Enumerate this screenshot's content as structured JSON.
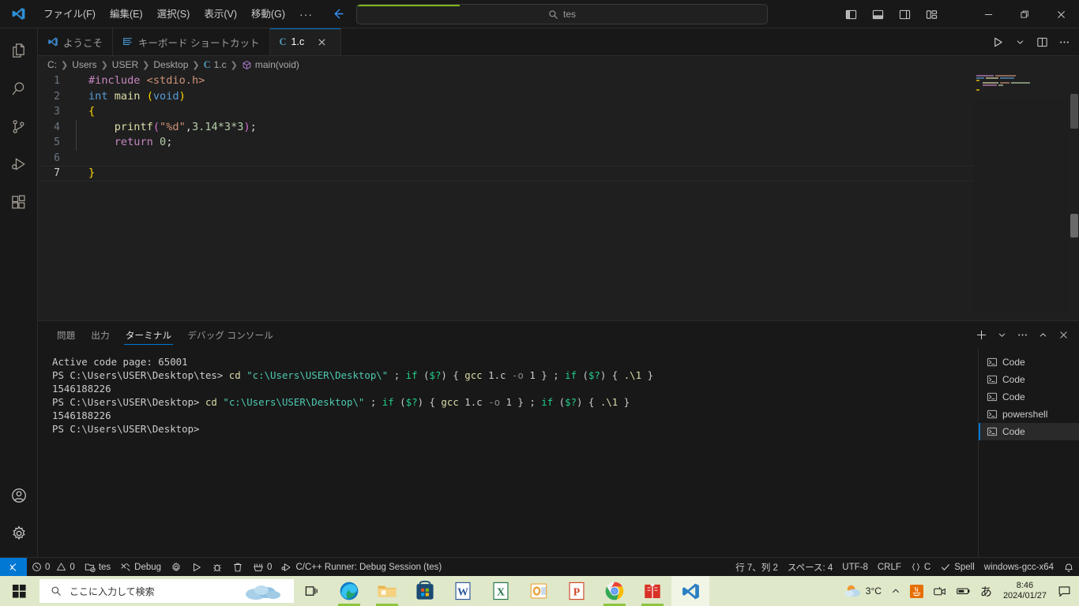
{
  "titlebar": {
    "logo_icon": "vscode-logo-icon",
    "menus": [
      {
        "label": "ファイル(F)",
        "name": "menu-file"
      },
      {
        "label": "編集(E)",
        "name": "menu-edit"
      },
      {
        "label": "選択(S)",
        "name": "menu-selection"
      },
      {
        "label": "表示(V)",
        "name": "menu-view"
      },
      {
        "label": "移動(G)",
        "name": "menu-go"
      }
    ],
    "more_label": "···",
    "back_icon": "arrow-left-icon",
    "forward_icon": "arrow-right-icon",
    "command_center": {
      "search_icon": "search-icon",
      "text": "tes",
      "placeholder": "tes",
      "progress_color": "#7cb518"
    },
    "layout_buttons": [
      {
        "name": "toggle-primary-sidebar-button",
        "icon": "layout-sidebar-left-icon"
      },
      {
        "name": "toggle-panel-button",
        "icon": "layout-panel-icon"
      },
      {
        "name": "toggle-secondary-sidebar-button",
        "icon": "layout-sidebar-right-icon"
      },
      {
        "name": "customize-layout-button",
        "icon": "layout-customize-icon"
      }
    ],
    "window_controls": [
      {
        "name": "minimize-button",
        "icon": "minimize-icon"
      },
      {
        "name": "maximize-restore-button",
        "icon": "restore-icon"
      },
      {
        "name": "close-window-button",
        "icon": "close-icon"
      }
    ]
  },
  "activitybar": {
    "top_items": [
      {
        "name": "activity-explorer",
        "icon": "files-icon",
        "label": "エクスプローラー"
      },
      {
        "name": "activity-search",
        "icon": "search-icon",
        "label": "検索"
      },
      {
        "name": "activity-source-control",
        "icon": "source-control-icon",
        "label": "ソース管理"
      },
      {
        "name": "activity-run-debug",
        "icon": "run-and-debug-icon",
        "label": "実行とデバッグ"
      },
      {
        "name": "activity-extensions",
        "icon": "extensions-icon",
        "label": "拡張機能"
      }
    ],
    "bottom_items": [
      {
        "name": "activity-accounts",
        "icon": "account-icon",
        "label": "アカウント"
      },
      {
        "name": "activity-settings",
        "icon": "gear-icon",
        "label": "管理"
      }
    ]
  },
  "editor": {
    "tabs": [
      {
        "label": "ようこそ",
        "icon": "vscode-logo-icon",
        "active": false,
        "name": "tab-welcome"
      },
      {
        "label": "キーボード ショートカット",
        "icon": "keyboard-shortcuts-icon",
        "active": false,
        "name": "tab-keyboard-shortcuts"
      },
      {
        "label": "1.c",
        "icon": "c-file-icon",
        "active": true,
        "name": "tab-1-c",
        "close_icon": "close-icon"
      }
    ],
    "actions": [
      {
        "name": "run-code-button",
        "icon": "play-icon"
      },
      {
        "name": "run-options-dropdown",
        "icon": "chevron-down-icon"
      },
      {
        "name": "split-editor-button",
        "icon": "split-editor-icon"
      },
      {
        "name": "more-editor-actions-button",
        "icon": "ellipsis-icon"
      }
    ],
    "breadcrumbs": [
      {
        "label": "C:",
        "name": "breadcrumb-drive"
      },
      {
        "label": "Users",
        "name": "breadcrumb-users"
      },
      {
        "label": "USER",
        "name": "breadcrumb-user"
      },
      {
        "label": "Desktop",
        "name": "breadcrumb-desktop"
      },
      {
        "label": "1.c",
        "name": "breadcrumb-file",
        "icon": "c-file-icon"
      },
      {
        "label": "main(void)",
        "name": "breadcrumb-symbol",
        "icon": "symbol-method-icon"
      }
    ],
    "line_numbers": [
      "1",
      "2",
      "3",
      "4",
      "5",
      "6",
      "7"
    ],
    "code": {
      "l1_include": "#include",
      "l1_header": "<stdio.h>",
      "l2_int": "int",
      "l2_main": "main",
      "l2_open": "(",
      "l2_void": "void",
      "l2_close": ")",
      "l3_brace": "{",
      "l4_printf": "printf",
      "l4_open": "(",
      "l4_str": "\"%d\"",
      "l4_comma": ",",
      "l4_expr": "3.14*3*3",
      "l4_close": ")",
      "l4_semi": ";",
      "l5_return": "return",
      "l5_zero": "0",
      "l5_semi": ";",
      "l6_empty": "",
      "l7_brace": "}"
    }
  },
  "panel": {
    "tabs": [
      {
        "label": "問題",
        "active": false,
        "name": "panel-tab-problems"
      },
      {
        "label": "出力",
        "active": false,
        "name": "panel-tab-output"
      },
      {
        "label": "ターミナル",
        "active": true,
        "name": "panel-tab-terminal"
      },
      {
        "label": "デバッグ コンソール",
        "active": false,
        "name": "panel-tab-debug-console"
      }
    ],
    "actions": [
      {
        "name": "new-terminal-button",
        "icon": "plus-icon"
      },
      {
        "name": "terminal-profile-dropdown",
        "icon": "chevron-down-icon"
      },
      {
        "name": "panel-more-actions-button",
        "icon": "ellipsis-icon"
      },
      {
        "name": "maximize-panel-button",
        "icon": "chevron-up-icon"
      },
      {
        "name": "close-panel-button",
        "icon": "close-icon"
      }
    ],
    "terminal_lines": [
      {
        "segments": [
          {
            "text": "Active code page: 65001",
            "color": "white"
          }
        ]
      },
      {
        "segments": [
          {
            "text": "PS C:\\Users\\USER\\Desktop\\tes> ",
            "color": "white"
          },
          {
            "text": "cd",
            "color": "yellow2"
          },
          {
            "text": " ",
            "color": "white"
          },
          {
            "text": "\"c:\\Users\\USER\\Desktop\\\"",
            "color": "cyan"
          },
          {
            "text": " ",
            "color": "white"
          },
          {
            "text": ";",
            "color": "white"
          },
          {
            "text": " ",
            "color": "white"
          },
          {
            "text": "if",
            "color": "green"
          },
          {
            "text": " ",
            "color": "white"
          },
          {
            "text": "(",
            "color": "white"
          },
          {
            "text": "$?",
            "color": "green"
          },
          {
            "text": ") { ",
            "color": "white"
          },
          {
            "text": "gcc",
            "color": "yellow2"
          },
          {
            "text": " 1.c ",
            "color": "white"
          },
          {
            "text": "-o",
            "color": "gray"
          },
          {
            "text": " 1 } ; ",
            "color": "white"
          },
          {
            "text": "if",
            "color": "green"
          },
          {
            "text": " (",
            "color": "white"
          },
          {
            "text": "$?",
            "color": "green"
          },
          {
            "text": ") { ",
            "color": "white"
          },
          {
            "text": ".\\1",
            "color": "yellow2"
          },
          {
            "text": " }",
            "color": "white"
          }
        ]
      },
      {
        "segments": [
          {
            "text": "1546188226",
            "color": "white"
          }
        ]
      },
      {
        "segments": [
          {
            "text": "PS C:\\Users\\USER\\Desktop> ",
            "color": "white"
          },
          {
            "text": "cd",
            "color": "yellow2"
          },
          {
            "text": " ",
            "color": "white"
          },
          {
            "text": "\"c:\\Users\\USER\\Desktop\\\"",
            "color": "cyan"
          },
          {
            "text": " ; ",
            "color": "white"
          },
          {
            "text": "if",
            "color": "green"
          },
          {
            "text": " (",
            "color": "white"
          },
          {
            "text": "$?",
            "color": "green"
          },
          {
            "text": ") { ",
            "color": "white"
          },
          {
            "text": "gcc",
            "color": "yellow2"
          },
          {
            "text": " 1.c ",
            "color": "white"
          },
          {
            "text": "-o",
            "color": "gray"
          },
          {
            "text": " 1 } ; ",
            "color": "white"
          },
          {
            "text": "if",
            "color": "green"
          },
          {
            "text": " (",
            "color": "white"
          },
          {
            "text": "$?",
            "color": "green"
          },
          {
            "text": ") { ",
            "color": "white"
          },
          {
            "text": ".\\1",
            "color": "yellow2"
          },
          {
            "text": " }",
            "color": "white"
          }
        ]
      },
      {
        "segments": [
          {
            "text": "1546188226",
            "color": "white"
          }
        ]
      },
      {
        "segments": [
          {
            "text": "PS C:\\Users\\USER\\Desktop>",
            "color": "white"
          }
        ]
      }
    ],
    "terminal_list": [
      {
        "label": "Code",
        "icon": "terminal-icon",
        "active": false,
        "name": "terminal-list-item-code-1"
      },
      {
        "label": "Code",
        "icon": "terminal-icon",
        "active": false,
        "name": "terminal-list-item-code-2"
      },
      {
        "label": "Code",
        "icon": "terminal-icon",
        "active": false,
        "name": "terminal-list-item-code-3"
      },
      {
        "label": "powershell",
        "icon": "terminal-icon",
        "active": false,
        "name": "terminal-list-item-powershell"
      },
      {
        "label": "Code",
        "icon": "terminal-icon",
        "active": true,
        "name": "terminal-list-item-code-4"
      }
    ]
  },
  "statusbar": {
    "remote_icon": "remote-window-icon",
    "left_items": [
      {
        "name": "problems-status",
        "icon": "error-warning-icon",
        "label": "0",
        "label2": "0"
      },
      {
        "name": "folder-status",
        "icon": "folder-checked-icon",
        "label": "tes"
      },
      {
        "name": "debug-status",
        "icon": "tools-icon",
        "label": "Debug"
      },
      {
        "name": "settings-gear-status",
        "icon": "gear-icon",
        "label": ""
      },
      {
        "name": "run-status",
        "icon": "play-icon",
        "label": ""
      },
      {
        "name": "debug-bug-status",
        "icon": "bug-icon",
        "label": ""
      },
      {
        "name": "clear-output-status",
        "icon": "trash-icon",
        "label": ""
      },
      {
        "name": "ports-status",
        "icon": "ports-icon",
        "label": "0"
      },
      {
        "name": "runner-status",
        "icon": "debug-alt-icon",
        "label": "C/C++ Runner: Debug Session (tes)"
      }
    ],
    "right_items": [
      {
        "name": "cursor-position-status",
        "label": "行 7、列 2"
      },
      {
        "name": "indentation-status",
        "label": "スペース: 4"
      },
      {
        "name": "encoding-status",
        "label": "UTF-8"
      },
      {
        "name": "eol-status",
        "label": "CRLF"
      },
      {
        "name": "language-mode-status",
        "label": "C",
        "icon": "braces-icon"
      },
      {
        "name": "spell-checker-status",
        "label": "Spell",
        "icon": "check-icon"
      },
      {
        "name": "compiler-status",
        "label": "windows-gcc-x64"
      },
      {
        "name": "notifications-status",
        "label": "",
        "icon": "bell-icon"
      }
    ]
  },
  "taskbar": {
    "start_icon": "windows-logo-icon",
    "search": {
      "icon": "search-icon",
      "placeholder": "ここに入力して検索",
      "value": "ここに入力して検索",
      "cloud_icon": "weather-cloud-icon"
    },
    "taskview_icon": "task-view-icon",
    "apps": [
      {
        "name": "taskbar-app-edge",
        "icon": "edge-icon",
        "running": true,
        "active": false
      },
      {
        "name": "taskbar-app-file-explorer",
        "icon": "folder-icon",
        "running": true,
        "active": false
      },
      {
        "name": "taskbar-app-microsoft-store",
        "icon": "store-icon",
        "running": false,
        "active": false
      },
      {
        "name": "taskbar-app-word",
        "icon": "word-icon",
        "running": false,
        "active": false
      },
      {
        "name": "taskbar-app-excel",
        "icon": "excel-icon",
        "running": false,
        "active": false
      },
      {
        "name": "taskbar-app-outlook",
        "icon": "outlook-icon",
        "running": false,
        "active": false
      },
      {
        "name": "taskbar-app-powerpoint",
        "icon": "powerpoint-icon",
        "running": false,
        "active": false
      },
      {
        "name": "taskbar-app-chrome",
        "icon": "chrome-icon",
        "running": true,
        "active": false
      },
      {
        "name": "taskbar-app-pdf",
        "icon": "pdf-reader-icon",
        "running": true,
        "active": false
      },
      {
        "name": "taskbar-app-vscode",
        "icon": "vscode-logo-icon",
        "running": true,
        "active": true
      }
    ],
    "tray": {
      "weather_icon": "weather-partly-cloudy-icon",
      "temperature": "3°C",
      "chevron_icon": "chevron-up-icon",
      "java_icon": "java-icon",
      "camera_icon": "camera-icon",
      "battery_icon": "battery-icon",
      "ime_label": "あ",
      "time": "8:46",
      "date": "2024/01/27",
      "action_center_icon": "action-center-icon"
    }
  }
}
